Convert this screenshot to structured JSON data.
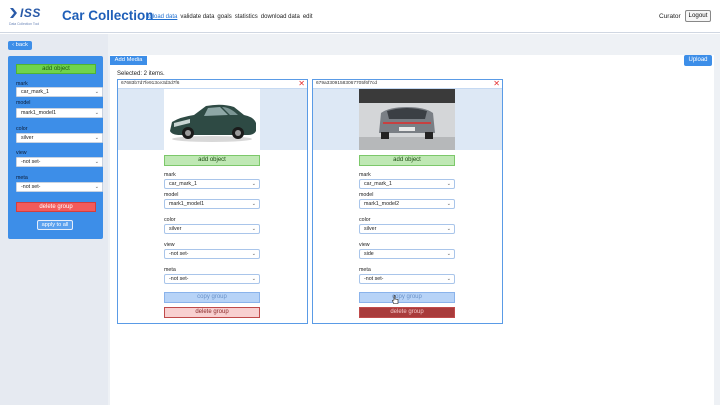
{
  "header": {
    "logo_text": "ISS",
    "logo_subtitle": "Data Collection Tool",
    "app_title": "Car Collection",
    "nav": [
      "upload data",
      "validate data",
      "goals",
      "statistics",
      "download data",
      "edit"
    ],
    "nav_active": "upload data",
    "user": "Curator",
    "logout_label": "Logout"
  },
  "back_label": "back",
  "group_panel": {
    "add_object_label": "add object",
    "fields": [
      {
        "label": "mark",
        "value": "car_mark_1"
      },
      {
        "label": "model",
        "value": "mark1_model1"
      },
      {
        "label": "color",
        "value": "silver"
      },
      {
        "label": "view",
        "value": "-not set-"
      },
      {
        "label": "meta",
        "value": "-not set-"
      }
    ],
    "delete_group_label": "delete group",
    "apply_all_label": "apply to all"
  },
  "toolbar": {
    "add_media_label": "Add Media",
    "upload_label": "Upload",
    "selected_text": "Selected: 2 items."
  },
  "cards": [
    {
      "id": "67683b7d7fe913ce3d3d7f6",
      "photo": "sedan-front-side",
      "add_object_label": "add object",
      "fields": [
        {
          "label": "mark",
          "value": "car_mark_1"
        },
        {
          "label": "model",
          "value": "mark1_model1"
        },
        {
          "label": "color",
          "value": "silver"
        },
        {
          "label": "view",
          "value": "-not set-"
        },
        {
          "label": "meta",
          "value": "-not set-"
        }
      ],
      "copy_label": "copy group",
      "delete_label": "delete group"
    },
    {
      "id": "679a33091583067705f6f7cd",
      "photo": "car-rear",
      "add_object_label": "add object",
      "fields": [
        {
          "label": "mark",
          "value": "car_mark_1"
        },
        {
          "label": "model",
          "value": "mark1_model2"
        },
        {
          "label": "color",
          "value": "silver"
        },
        {
          "label": "view",
          "value": "side"
        },
        {
          "label": "meta",
          "value": "-not set-"
        }
      ],
      "copy_label": "copy group",
      "delete_label": "delete group"
    }
  ],
  "icons": {
    "close": "close-x-icon",
    "chevron": "chevron-down-icon"
  },
  "colors": {
    "primary": "#3d8ee8",
    "add": "#6fd44c",
    "delete": "#f35b5b",
    "close": "#e53030"
  }
}
